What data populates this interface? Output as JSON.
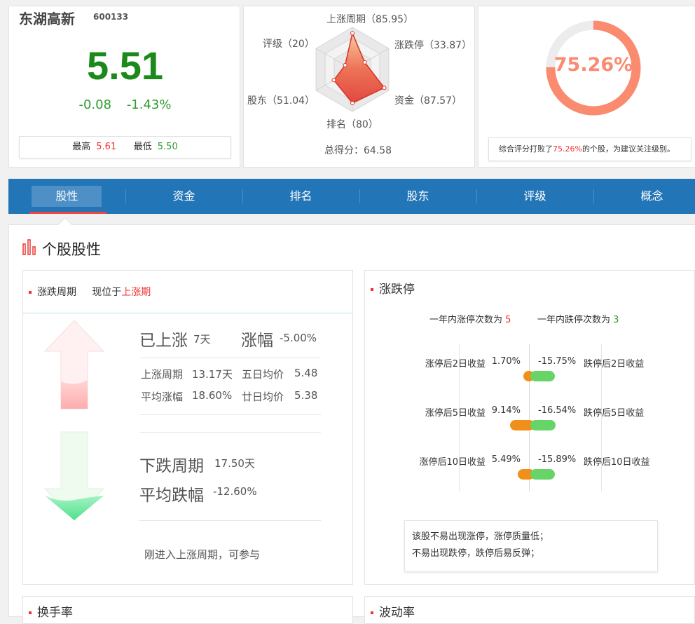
{
  "stock": {
    "name": "东湖高新",
    "code": "600133",
    "price": "5.51",
    "change": "-0.08",
    "change_pct": "-1.43%",
    "high_label": "最高",
    "high": "5.61",
    "low_label": "最低",
    "low": "5.50"
  },
  "radar": {
    "axes": [
      {
        "label": "上涨周期（85.95）",
        "value": 85.95
      },
      {
        "label": "涨跌停（33.87）",
        "value": 33.87
      },
      {
        "label": "资金（87.57）",
        "value": 87.57
      },
      {
        "label": "排名（80）",
        "value": 80
      },
      {
        "label": "股东（51.04）",
        "value": 51.04
      },
      {
        "label": "评级（20）",
        "value": 20
      }
    ],
    "total": "总得分：64.58",
    "colors": {
      "fill": "#e8433a",
      "stroke": "#d8322b"
    }
  },
  "gauge": {
    "percent_text": "75.26%",
    "percent_value": 75.26,
    "note_pre": "综合评分打败了",
    "note_pct": "75.26%",
    "note_post": "的个股，为建议关注级别。",
    "colors": {
      "arc": "#fb8b6f",
      "track": "#ececec"
    }
  },
  "nav": {
    "tabs": [
      "股性",
      "资金",
      "排名",
      "股东",
      "评级",
      "概念"
    ],
    "active": 0
  },
  "section": {
    "title": "个股股性"
  },
  "cycle": {
    "header_label": "涨跌周期",
    "header_pos": "现位于",
    "header_state": "上涨期",
    "up_label": "已上涨",
    "up_days": "7天",
    "range_label": "涨幅",
    "range_value": "-5.00%",
    "up_cycle_label": "上涨周期",
    "up_cycle_value": "13.17天",
    "ma5_label": "五日均价",
    "ma5_value": "5.48",
    "avg_rise_label": "平均涨幅",
    "avg_rise_value": "18.60%",
    "ma20_label": "廿日均价",
    "ma20_value": "5.38",
    "down_cycle_label": "下跌周期",
    "down_cycle_value": "17.50天",
    "avg_fall_label": "平均跌幅",
    "avg_fall_value": "-12.60%",
    "advice": "刚进入上涨周期，可参与"
  },
  "limit": {
    "title": "涨跌停",
    "up_count_label": "一年内涨停次数为",
    "up_count": "5",
    "down_count_label": "一年内跌停次数为",
    "down_count": "3",
    "rows": [
      {
        "up_label": "涨停后2日收益",
        "up_value": "1.70%",
        "down_value": "-15.75%",
        "down_label": "跌停后2日收益",
        "up_num": 1.7,
        "down_num": 15.75
      },
      {
        "up_label": "涨停后5日收益",
        "up_value": "9.14%",
        "down_value": "-16.54%",
        "down_label": "跌停后5日收益",
        "up_num": 9.14,
        "down_num": 16.54
      },
      {
        "up_label": "涨停后10日收益",
        "up_value": "5.49%",
        "down_value": "-15.89%",
        "down_label": "跌停后10日收益",
        "up_num": 5.49,
        "down_num": 15.89
      }
    ],
    "note1": "该股不易出现涨停，涨停质量低；",
    "note2": "不易出现跌停，跌停后易反弹；"
  },
  "bottom": {
    "left_title": "换手率",
    "right_title": "波动率"
  }
}
